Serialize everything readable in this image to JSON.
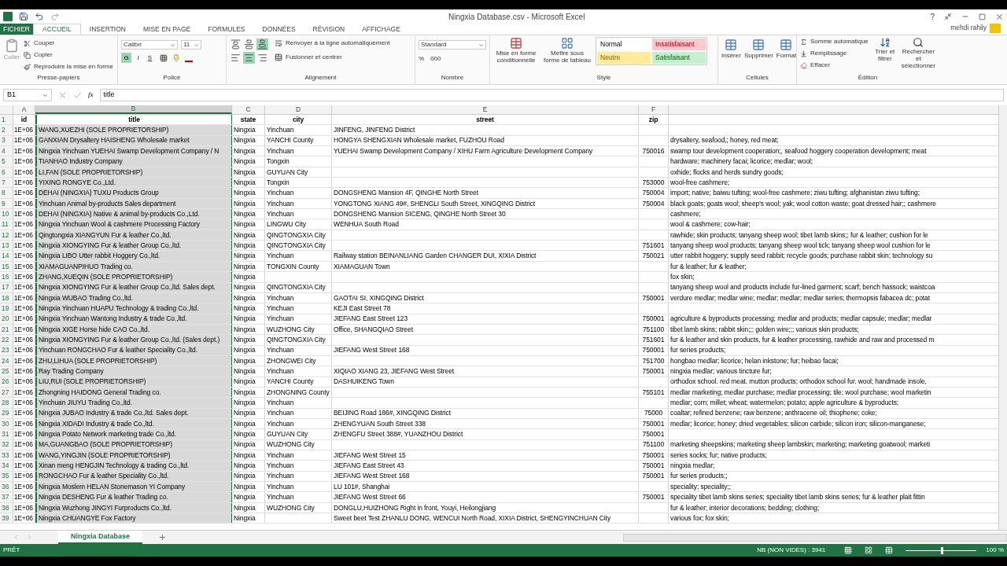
{
  "window": {
    "title": "Ningxia Database.csv - Microsoft Excel",
    "user": "mehdi rahily",
    "controls": [
      "?"
    ]
  },
  "ribbon_tabs": [
    {
      "label": "FICHIER",
      "kind": "file",
      "selected": false
    },
    {
      "label": "ACCUEIL",
      "kind": "tab",
      "selected": true
    },
    {
      "label": "INSERTION",
      "kind": "tab",
      "selected": false
    },
    {
      "label": "MISE EN PAGE",
      "kind": "tab",
      "selected": false
    },
    {
      "label": "FORMULES",
      "kind": "tab",
      "selected": false
    },
    {
      "label": "DONNÉES",
      "kind": "tab",
      "selected": false
    },
    {
      "label": "RÉVISION",
      "kind": "tab",
      "selected": false
    },
    {
      "label": "AFFICHAGE",
      "kind": "tab",
      "selected": false
    }
  ],
  "clipboard": {
    "paste": "Coller",
    "cut": "Couper",
    "copy": "Copier",
    "format_painter": "Reproduire la mise en forme",
    "group": "Presse-papiers"
  },
  "font": {
    "family": "Calibri",
    "size": "11",
    "buttons": [
      {
        "label": "G",
        "on": true
      },
      {
        "label": "I",
        "on": false
      },
      {
        "label": "S",
        "on": false
      }
    ],
    "group": "Police"
  },
  "alignment": {
    "buttons": [
      {
        "kind": "top",
        "on": false
      },
      {
        "kind": "middle",
        "on": false
      },
      {
        "kind": "bottom",
        "on": true
      },
      {
        "kind": "left",
        "on": false
      },
      {
        "kind": "center",
        "on": true
      },
      {
        "kind": "right",
        "on": false
      }
    ],
    "wrap": "Renvoyer à la ligne automatiquement",
    "merge": "Fusionner et centrer",
    "group": "Alignement"
  },
  "number": {
    "format": "Standard",
    "percent": "%",
    "thousands": "000",
    "group": "Nombre"
  },
  "styles": {
    "conditional": "Mise en forme conditionnelle",
    "table": "Mettre sous forme de tableau",
    "cell_styles": [
      {
        "label": "Normal",
        "color": "#ffffff"
      },
      {
        "label": "Insatisfaisant",
        "color": "#ffc7ce"
      },
      {
        "label": "Neutre",
        "color": "#ffeb9c"
      },
      {
        "label": "Satisfaisant",
        "color": "#c6efce"
      }
    ],
    "group": "Style"
  },
  "cells": {
    "buttons": [
      "Insérer",
      "Supprimer",
      "Format"
    ],
    "group": "Cellules"
  },
  "editing": {
    "autosum": "Somme automatique",
    "fill": "Remplissage",
    "clear": "Effacer",
    "sort": "Trier et filtrer",
    "find": "Rechercher et sélectionner",
    "group": "Édition"
  },
  "formula_bar": {
    "name_box": "B1",
    "function_label": "fx",
    "formula": "title"
  },
  "columns": [
    {
      "letter": "A",
      "selected": false
    },
    {
      "letter": "B",
      "selected": true
    },
    {
      "letter": "C",
      "selected": false
    },
    {
      "letter": "D",
      "selected": false
    },
    {
      "letter": "E",
      "selected": false
    },
    {
      "letter": "F",
      "selected": false
    }
  ],
  "header_row": {
    "row": "1",
    "id": "id",
    "title": "title",
    "state": "state",
    "city": "city",
    "street": "street",
    "zip": "zip"
  },
  "rows": [
    {
      "row": "2",
      "id": "1E+06",
      "title": "WANG,XUEZHI (SOLE PROPRIETORSHIP)",
      "state": "Ningxia",
      "city": "Yinchuan",
      "street": "JINFENG, JINFENG District"
    },
    {
      "row": "3",
      "id": "1E+06",
      "title": "GANXIAN Drysaltery HAISHENG Wholesale market",
      "state": "Ningxia",
      "city": "YANCHI County",
      "street": "HONGYA SHENGXIAN Wholesale market, FUZHOU Road",
      "column_g": "drysaltery, seafood,; honey, red meat;"
    },
    {
      "row": "4",
      "id": "1E+06",
      "title": "Ningxia Yinchuan YUEHAI Swamp Development Company / N",
      "state": "Ningxia",
      "city": "Yinchuan",
      "street": "YUEHAI Swamp Development Company / XIHU Farm Agriculture Development Company",
      "zip": "750016",
      "column_g": "swamp tour development cooperation;, seafood hoggery cooperation development; meat"
    },
    {
      "row": "5",
      "id": "1E+06",
      "title": "TIANHAO Industry Company",
      "state": "Ningxia",
      "city": "Tongxin",
      "column_g": "hardware; machinery facai; licorice; medlar; wool;"
    },
    {
      "row": "6",
      "id": "1E+06",
      "title": "LI,FAN (SOLE PROPRIETORSHIP)",
      "state": "Ningxia",
      "city": "GUYUAN City",
      "column_g": "oxhide; flocks and herds sundry goods;"
    },
    {
      "row": "7",
      "id": "1E+06",
      "title": "YIXING RONGYE Co.,Ltd.",
      "state": "Ningxia",
      "city": "Tongxin",
      "zip": "753000",
      "column_g": "wool-free cashmere;"
    },
    {
      "row": "8",
      "id": "1E+06",
      "title": "DEHAI (NINGXIA) TUXU Products Group",
      "state": "Ningxia",
      "city": "Yinchuan",
      "street": "DONGSHENG Mansion 4F, QINGHE North Street",
      "zip": "750004",
      "column_g": "import; native; baiwu tufting; wool-free cashmere; ziwu tufting; afghanistan ziwu tufting;"
    },
    {
      "row": "9",
      "id": "1E+06",
      "title": "Yinchuan Animal by-products Sales department",
      "state": "Ningxia",
      "city": "Yinchuan",
      "street": "YONGTONG XIANG 49#, SHENGLI South Street, XINGQING District",
      "zip": "750004",
      "column_g": "black goats; goats wool; sheep's wool; yak; wool cotton waste; goat dressed hair;; cashmere"
    },
    {
      "row": "10",
      "id": "1E+06",
      "title": "DEHAI (NINGXIA) Native & animal by-products Co.,Ltd.",
      "state": "Ningxia",
      "city": "Yinchuan",
      "street": "DONGSHENG Mansion SICENG, QINGHE North Street 30",
      "column_g": "cashmere;"
    },
    {
      "row": "11",
      "id": "1E+06",
      "title": "Ningxia Yinchuan Wool & cashmere Processing Factory",
      "state": "Ningxia",
      "city": "LINGWU City",
      "street": "WENHUA South Road",
      "column_g": "wool & cashmere; cow-hair;"
    },
    {
      "row": "12",
      "id": "1E+06",
      "title": "Qingtongxia XIANGYUN Fur & leather Co.,ltd.",
      "state": "Ningxia",
      "city": "QINGTONGXIA City",
      "column_g": "rawhide; skin products; tanyang sheep wool; tibet lamb skins;; fur & leather; cushion for le"
    },
    {
      "row": "13",
      "id": "1E+06",
      "title": "Ningxia XIONGYING Fur & leather Group Co.,ltd.",
      "state": "Ningxia",
      "city": "QINGTONGXIA City",
      "zip": "751601",
      "column_g": "tanyang sheep wool products; tanyang sheep wool tick; tanyang sheep wool cushion for le"
    },
    {
      "row": "14",
      "id": "1E+06",
      "title": "Ningxia LIBO Utter rabbit Hoggery Co.,ltd.",
      "state": "Ningxia",
      "city": "Yinchuan",
      "street": "Railway station BEINANLIANG Garden CHANGER DUI, XIXIA District",
      "zip": "750021",
      "column_g": "utter rabbit hoggery; supply seed rabbit; recycle goods; purchase rabbit skin; technology su"
    },
    {
      "row": "15",
      "id": "1E+06",
      "title": "XIAMAGUANPIHUO Trading co.",
      "state": "Ningxia",
      "city": "TONGXIN County",
      "street": "XIAMAGUAN Town",
      "column_g": "fur & leather; fur & leather;"
    },
    {
      "row": "16",
      "id": "1E+06",
      "title": "ZHANG,XUEQIN (SOLE PROPRIETORSHIP)",
      "state": "Ningxia",
      "column_g": "fox skin;"
    },
    {
      "row": "17",
      "id": "1E+06",
      "title": "Ningxia XIONGYING Fur & leather Group Co.,ltd. Sales dept.",
      "state": "Ningxia",
      "city": "QINGTONGXIA City",
      "column_g": "tanyang sheep wool and products include fur-lined garment; scarf; bench hassock; waistcoa"
    },
    {
      "row": "18",
      "id": "1E+06",
      "title": "Ningxia WUBAO Trading Co.,ltd.",
      "state": "Ningxia",
      "city": "Yinchuan",
      "street": "GAOTAI SI, XINGQING District",
      "zip": "750001",
      "column_g": "verdure medlar; medlar wine; medlar; medlar; medlar series; thermopsis fabacea dc; potat"
    },
    {
      "row": "19",
      "id": "1E+06",
      "title": "Ningxia Yinchuan HUAPU Technology & trading Co.,ltd.",
      "state": "Ningxia",
      "city": "Yinchuan",
      "street": "KEJI East Street 78"
    },
    {
      "row": "20",
      "id": "1E+06",
      "title": "Ningxia Yinchuan Wantong Industry & trade Co.,ltd.",
      "state": "Ningxia",
      "city": "Yinchuan",
      "street": "JIEFANG East Street 123",
      "zip": "750001",
      "column_g": "agriculture & byproducts processing; medlar and products; medlar capsule; medlar; medlar"
    },
    {
      "row": "21",
      "id": "1E+06",
      "title": "Ningxia XIGE Horse hide CAO Co.,ltd.",
      "state": "Ningxia",
      "city": "WUZHONG City",
      "street": "Office, SHANGQIAO Street",
      "zip": "751100",
      "column_g": "tibet lamb skins; rabbit skin;;; golden wire;;; various skin products;"
    },
    {
      "row": "22",
      "id": "1E+06",
      "title": "Ningxia XIONGYING Fur & leather Group Co.,ltd. (Sales dept.)",
      "state": "Ningxia",
      "city": "QINGTONGXIA City",
      "zip": "751601",
      "column_g": "fur & leather and skin products, fur & leather processing, rawhide and raw and processed m"
    },
    {
      "row": "23",
      "id": "1E+06",
      "title": "Yinchuan RONGCHAO Fur & leather Speciality Co.,ltd.",
      "state": "Ningxia",
      "city": "Yinchuan",
      "street": "JIEFANG West Street 168",
      "zip": "750001",
      "column_g": "fur series products;"
    },
    {
      "row": "24",
      "id": "1E+06",
      "title": "ZHU,LIHUA (SOLE PROPRIETORSHIP)",
      "state": "Ningxia",
      "city": "ZHONGWEI City",
      "zip": "751700",
      "column_g": "hongbao medlar; licorice; helan inkstone; fur; heibao facai;"
    },
    {
      "row": "25",
      "id": "1E+06",
      "title": "Ray Trading Company",
      "state": "Ningxia",
      "city": "Yinchuan",
      "street": "XIQIAO XIANG 23, JIEFANG West Street",
      "zip": "750001",
      "column_g": "ningxia medlar; various tincture fur;"
    },
    {
      "row": "26",
      "id": "1E+06",
      "title": "LIU,RUI (SOLE PROPRIETORSHIP)",
      "state": "Ningxia",
      "city": "YANCHI County",
      "street": "DASHUIKENG Town",
      "column_g": "orthodox school. red meat. mutton products; orthodox school fur. wool; handmade insole,"
    },
    {
      "row": "27",
      "id": "1E+06",
      "title": "Zhongning HAIDONG General Trading co.",
      "state": "Ningxia",
      "city": "ZHONGNING County",
      "zip": "755101",
      "column_g": "medlar marketing; medlar purchase; medlar processing; tile; wool purchase; wool marketin"
    },
    {
      "row": "28",
      "id": "1E+06",
      "title": "Yinchuan JIUYU Trading Co.,ltd.",
      "state": "Ningxia",
      "city": "Yinchuan",
      "column_g": "medlar; corn; millet; wheat; watermelon; potato; apple agriculture & byproducts;"
    },
    {
      "row": "29",
      "id": "1E+06",
      "title": "Ningxia JUBAO Industry & trade Co.,ltd. Sales dept.",
      "state": "Ningxia",
      "city": "Yinchuan",
      "street": "BEIJING Road 186#, XINGQING District",
      "zip": "75000",
      "column_g": "coaltar; refined benzene; raw benzene; anthracene oil; thiophene; coke;"
    },
    {
      "row": "30",
      "id": "1E+06",
      "title": "Ningxia XIDADI Industry & trade Co.,ltd.",
      "state": "Ningxia",
      "city": "Yinchuan",
      "street": "ZHENGYUAN South Street 338",
      "zip": "750001",
      "column_g": "medlar; licorice; honey; dried vegetables; silicon carbide; silicon iron; silicon-manganese;"
    },
    {
      "row": "31",
      "id": "1E+06",
      "title": "Ningxia Potato Network marketing trade Co.,ltd.",
      "state": "Ningxia",
      "city": "GUYUAN City",
      "street": "ZHENGFU Street 388#, YUANZHOU District",
      "zip": "750001"
    },
    {
      "row": "32",
      "id": "1E+06",
      "title": "MA,GUANGBAO (SOLE PROPRIETORSHIP)",
      "state": "Ningxia",
      "city": "WUZHONG City",
      "zip": "751100",
      "column_g": "marketing sheepskins; marketing sheep lambskin; marketing; marketing goatwool; marketi"
    },
    {
      "row": "33",
      "id": "1E+06",
      "title": "WANG,YINGJIN (SOLE PROPRIETORSHIP)",
      "state": "Ningxia",
      "city": "Yinchuan",
      "street": "JIEFANG West Street 15",
      "zip": "750001",
      "column_g": "series socks; fur; native products;"
    },
    {
      "row": "34",
      "id": "1E+06",
      "title": "Xinan meng HENGJIN Technology & trading Co.,ltd.",
      "state": "Ningxia",
      "city": "Yinchuan",
      "street": "JIEFANG East Street 43",
      "zip": "750001",
      "column_g": "ningxia medlar;"
    },
    {
      "row": "35",
      "id": "1E+06",
      "title": "RONGCHAO Fur & leather Speciality Co.,ltd.",
      "state": "Ningxia",
      "city": "Yinchuan",
      "street": "JIEFANG West Street 168",
      "zip": "750001",
      "column_g": "fur series products;;"
    },
    {
      "row": "36",
      "id": "1E+06",
      "title": "Ningxia Moslem HELAN Stonemason YI Company",
      "state": "Ningxia",
      "city": "Yinchuan",
      "street": "LU 101#, Shanghai",
      "column_g": "speciality; speciality;;"
    },
    {
      "row": "37",
      "id": "1E+06",
      "title": "Ningxia DESHENG Fur & leather Trading co.",
      "state": "Ningxia",
      "city": "Yinchuan",
      "street": "JIEFANG West Street 66",
      "zip": "750001",
      "column_g": "speciality tibet lamb skins series; speciality tibet lamb skins series; fur & leather plait fittin"
    },
    {
      "row": "38",
      "id": "1E+06",
      "title": "Ningxia Wuzhong JINGYI Furproducts Co.,ltd.",
      "state": "Ningxia",
      "city": "WUZHONG City",
      "street": "DONGLU,HUIZHONG Right in front, Youyi, Heilongjiang",
      "column_g": "fur & leather; interior decorations; bedding; clothing;"
    },
    {
      "row": "39",
      "id": "1E+06",
      "title": "Ningxia CHUANGYE Fox Factory",
      "state": "Ningxia",
      "street": "Sweet beet Test ZHANLU DONG, WENCUI North Road, XIXIA District, SHENGYINCHUAN City",
      "column_g": "various fox; fox skin;"
    }
  ],
  "sheet_tabs": [
    {
      "label": "Ningxia Database",
      "selected": true
    }
  ],
  "status_bar": {
    "mode": "PRÊT",
    "count": "NB (NON VIDES) : 3941",
    "zoom": "100 %",
    "zoom_slider": {
      "level": 0.5
    }
  }
}
